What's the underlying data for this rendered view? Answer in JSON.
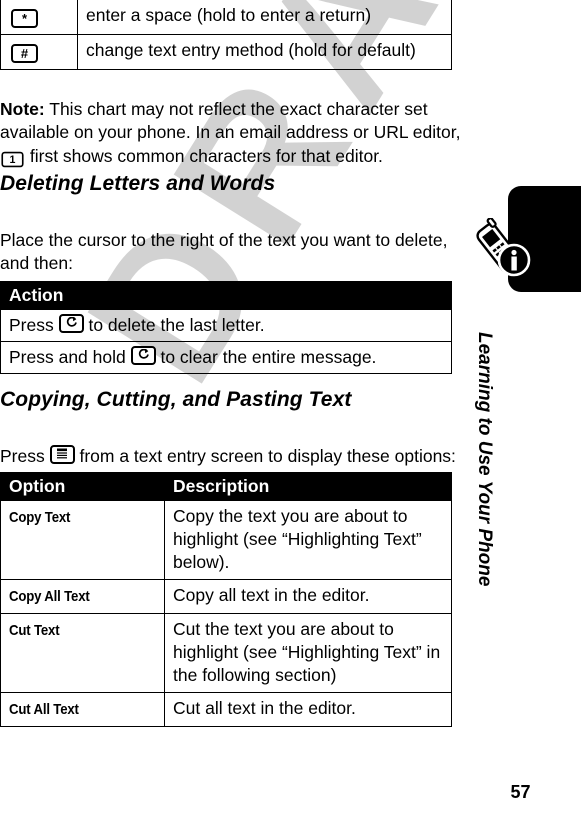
{
  "page": {
    "number": "57",
    "running_head": "Learning to Use Your Phone",
    "watermark": "DRAFT"
  },
  "key_chart_table": {
    "rows": [
      {
        "key": "*",
        "key_icon": "star-key-icon",
        "description": "enter a space (hold to enter a return)"
      },
      {
        "key": "#",
        "key_icon": "pound-key-icon",
        "description": "change text entry method (hold for default)"
      }
    ]
  },
  "note": {
    "label": "Note:",
    "text_before_key": " This chart may not reflect the exact character set available on your phone. In an email address or URL editor, ",
    "inline_key": "1",
    "inline_key_icon": "one-key-icon",
    "text_after_key": " first shows common characters for that editor."
  },
  "sections": [
    {
      "heading": "Deleting Letters and Words",
      "intro": "Place the cursor to the right of the text you want to delete, and then:"
    },
    {
      "heading": "Copying, Cutting, and Pasting Text",
      "intro_before_key": "Press ",
      "intro_key_icon": "menu-key-icon",
      "intro_after_key": " from a text entry screen to display these options:"
    }
  ],
  "action_table": {
    "header": "Action",
    "rows": [
      {
        "text_before_key": "Press ",
        "key_icon": "clear-key-icon",
        "text_after_key": " to delete the last letter."
      },
      {
        "text_before_key": "Press and hold ",
        "key_icon": "clear-key-icon",
        "text_after_key": " to clear the entire message."
      }
    ]
  },
  "options_table": {
    "headers": {
      "option": "Option",
      "description": "Description"
    },
    "rows": [
      {
        "option": "Copy Text",
        "description": "Copy the text you are about to highlight (see “Highlighting Text” below)."
      },
      {
        "option": "Copy All Text",
        "description": "Copy all text in the editor."
      },
      {
        "option": "Cut Text",
        "description": "Cut the text you are about to highlight (see “Highlighting Text” in the following section)"
      },
      {
        "option": "Cut All Text",
        "description": "Cut all text in the editor."
      }
    ]
  },
  "side_tab": {
    "phone_icon": "mobile-phone-icon",
    "info_icon": "info-circle-icon"
  },
  "colors": {
    "ink": "#000000",
    "paper": "#ffffff",
    "watermark": "#c9c9c9"
  }
}
